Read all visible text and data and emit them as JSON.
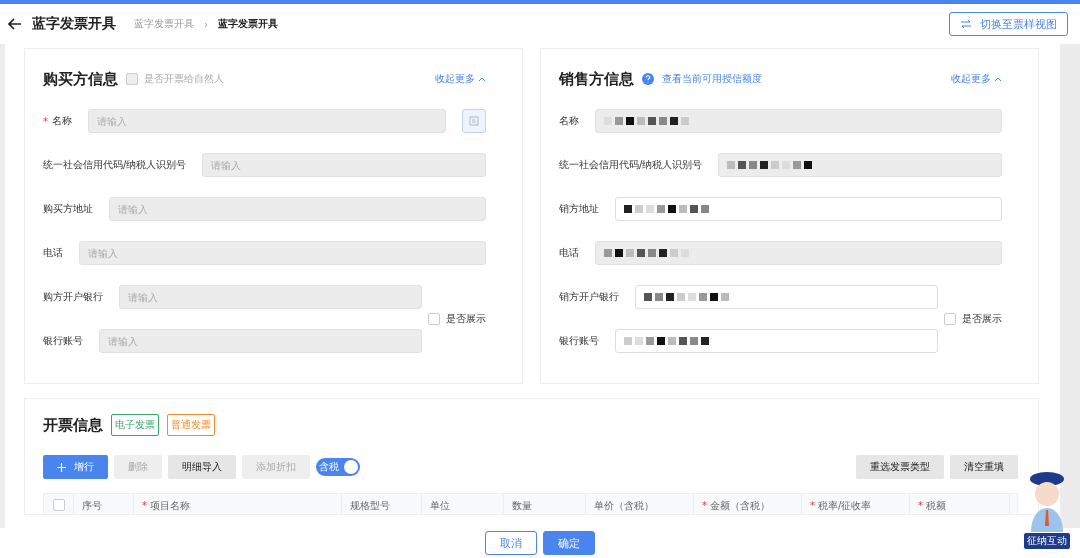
{
  "header": {
    "title": "蓝字发票开具",
    "breadcrumb": [
      {
        "label": "蓝字发票开具",
        "current": false
      },
      {
        "label": "蓝字发票开具",
        "current": true
      }
    ],
    "separator": "›",
    "switch_button": "切换至票样视图"
  },
  "buyer": {
    "title": "购买方信息",
    "natural_person": {
      "label": "是否开票给自然人",
      "checked": false,
      "disabled": true
    },
    "collapse_link": "收起更多",
    "fields": [
      {
        "label": "名称",
        "mark": "*",
        "placeholder": "请输入",
        "disabled": true,
        "picker": true
      },
      {
        "label": "统一社会信用代码/纳税人识别号",
        "placeholder": "请输入",
        "disabled": true
      },
      {
        "label": "购买方地址",
        "placeholder": "请输入",
        "disabled": true
      },
      {
        "label": "电话",
        "placeholder": "请输入",
        "disabled": true
      },
      {
        "label": "购方开户银行",
        "placeholder": "请输入",
        "disabled": true
      },
      {
        "label": "银行账号",
        "placeholder": "请输入",
        "disabled": true
      }
    ],
    "show_option": {
      "label": "是否展示",
      "checked": false
    }
  },
  "seller": {
    "title": "销售方信息",
    "credit_link": "查看当前可用授信额度",
    "collapse_link": "收起更多",
    "fields": [
      {
        "label": "名称",
        "disabled": true,
        "redacted": true
      },
      {
        "label": "统一社会信用代码/纳税人识别号",
        "disabled": true,
        "redacted": true
      },
      {
        "label": "销方地址",
        "disabled": false,
        "redacted": true
      },
      {
        "label": "电话",
        "disabled": true,
        "redacted": true
      },
      {
        "label": "销方开户银行",
        "disabled": false,
        "redacted": true
      },
      {
        "label": "银行账号",
        "disabled": false,
        "redacted": true
      }
    ],
    "show_option": {
      "label": "是否展示",
      "checked": false
    }
  },
  "invoice": {
    "title": "开票信息",
    "tags": [
      {
        "label": "电子发票",
        "color": "#3aa56b"
      },
      {
        "label": "普通发票",
        "color": "#f08a2c"
      }
    ],
    "actions": [
      {
        "label": "增行",
        "kind": "primary"
      },
      {
        "label": "删除",
        "kind": "disabled"
      },
      {
        "label": "明细导入",
        "kind": "default"
      },
      {
        "label": "添加折扣",
        "kind": "disabled"
      }
    ],
    "tax_toggle": {
      "label": "含税",
      "on": true
    },
    "right_actions": [
      "重选发票类型",
      "清空重填"
    ],
    "select_all": {
      "checked": false
    },
    "columns": [
      {
        "label": "序号"
      },
      {
        "label": "项目名称",
        "mark": "*"
      },
      {
        "label": "规格型号"
      },
      {
        "label": "单位"
      },
      {
        "label": "数量"
      },
      {
        "label": "单价（含税）"
      },
      {
        "label": "金额（含税）",
        "mark": "*"
      },
      {
        "label": "税率/征收率",
        "mark": "*"
      },
      {
        "label": "税额",
        "mark": "*"
      }
    ]
  },
  "footer": {
    "buttons": [
      {
        "label": "取消",
        "kind": "default"
      },
      {
        "label": "确定",
        "kind": "primary"
      }
    ]
  },
  "assistant": {
    "label": "征纳互动"
  }
}
